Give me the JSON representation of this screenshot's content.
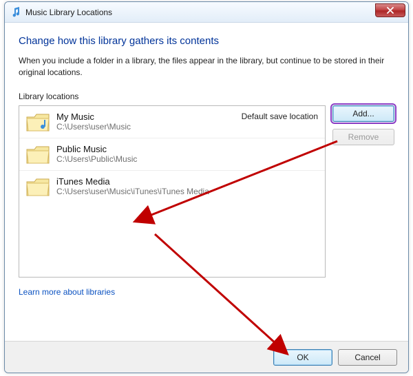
{
  "window": {
    "title": "Music Library Locations"
  },
  "heading": "Change how this library gathers its contents",
  "description": "When you include a folder in a library, the files appear in the library, but continue to be stored in their original locations.",
  "section_label": "Library locations",
  "buttons": {
    "add": "Add...",
    "remove": "Remove",
    "ok": "OK",
    "cancel": "Cancel"
  },
  "default_tag": "Default save location",
  "locations": [
    {
      "name": "My Music",
      "path": "C:\\Users\\user\\Music",
      "default": true
    },
    {
      "name": "Public Music",
      "path": "C:\\Users\\Public\\Music",
      "default": false
    },
    {
      "name": "iTunes Media",
      "path": "C:\\Users\\user\\Music\\iTunes\\iTunes Media",
      "default": false
    }
  ],
  "link": "Learn more about libraries"
}
